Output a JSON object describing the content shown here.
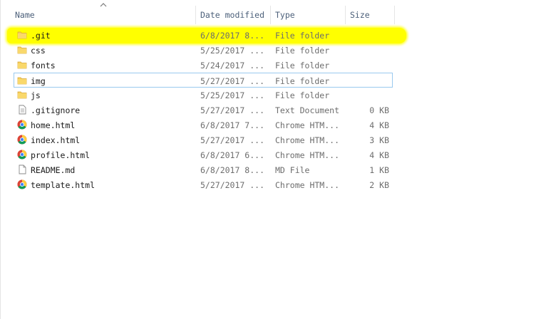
{
  "columns": {
    "name": "Name",
    "date": "Date modified",
    "type": "Type",
    "size": "Size"
  },
  "sort": {
    "column": "name",
    "icon": "sort-up-icon"
  },
  "highlight_color": "#ffff00",
  "folder_color": "#f5c542",
  "files": [
    {
      "name": ".git",
      "date": "6/8/2017 8...",
      "type": "File folder",
      "size": "",
      "icon": "folder-icon",
      "highlighted": true,
      "selected": false
    },
    {
      "name": "css",
      "date": "5/25/2017 ...",
      "type": "File folder",
      "size": "",
      "icon": "folder-icon",
      "highlighted": false,
      "selected": false
    },
    {
      "name": "fonts",
      "date": "5/24/2017 ...",
      "type": "File folder",
      "size": "",
      "icon": "folder-icon",
      "highlighted": false,
      "selected": false
    },
    {
      "name": "img",
      "date": "5/27/2017 ...",
      "type": "File folder",
      "size": "",
      "icon": "folder-icon",
      "highlighted": false,
      "selected": true
    },
    {
      "name": "js",
      "date": "5/25/2017 ...",
      "type": "File folder",
      "size": "",
      "icon": "folder-icon",
      "highlighted": false,
      "selected": false
    },
    {
      "name": ".gitignore",
      "date": "5/27/2017 ...",
      "type": "Text Document",
      "size": "0 KB",
      "icon": "text-document-icon",
      "highlighted": false,
      "selected": false
    },
    {
      "name": "home.html",
      "date": "6/8/2017 7...",
      "type": "Chrome HTM...",
      "size": "4 KB",
      "icon": "chrome-icon",
      "highlighted": false,
      "selected": false
    },
    {
      "name": "index.html",
      "date": "5/27/2017 ...",
      "type": "Chrome HTM...",
      "size": "3 KB",
      "icon": "chrome-icon",
      "highlighted": false,
      "selected": false
    },
    {
      "name": "profile.html",
      "date": "6/8/2017 6...",
      "type": "Chrome HTM...",
      "size": "4 KB",
      "icon": "chrome-icon",
      "highlighted": false,
      "selected": false
    },
    {
      "name": "README.md",
      "date": "6/8/2017 8...",
      "type": "MD File",
      "size": "1 KB",
      "icon": "file-icon",
      "highlighted": false,
      "selected": false
    },
    {
      "name": "template.html",
      "date": "5/27/2017 ...",
      "type": "Chrome HTM...",
      "size": "2 KB",
      "icon": "chrome-icon",
      "highlighted": false,
      "selected": false
    }
  ]
}
